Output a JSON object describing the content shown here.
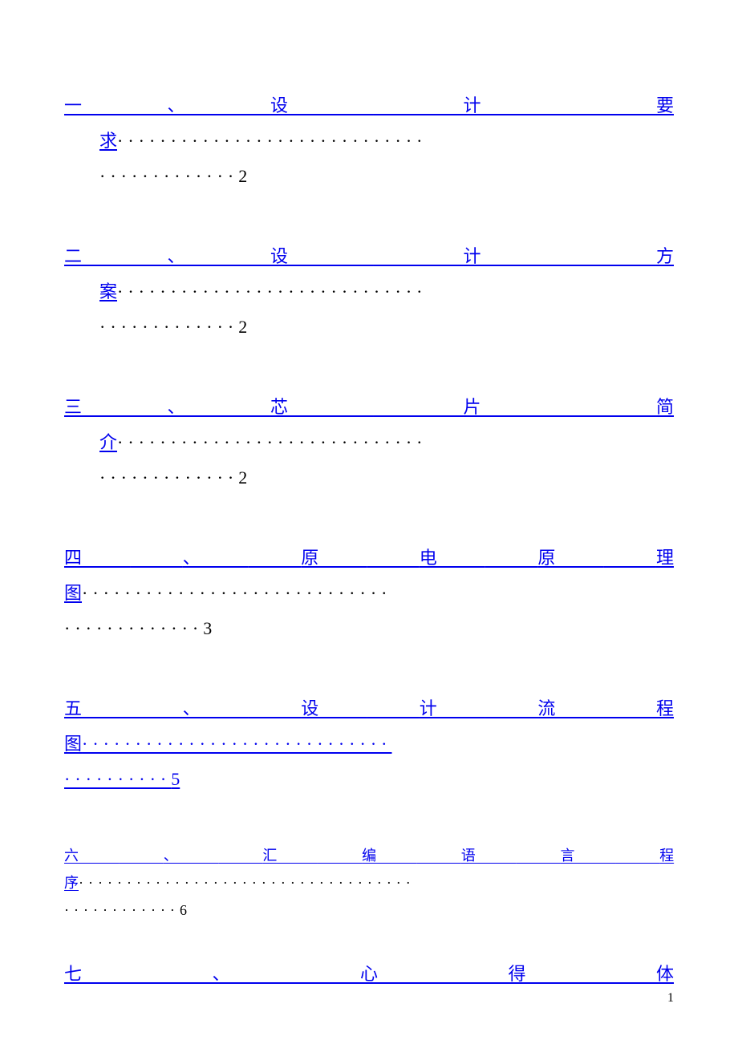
{
  "toc": [
    {
      "num": "一、",
      "title_chars": [
        "设",
        "计",
        "要",
        "求"
      ],
      "page": "2",
      "indent": true,
      "fullLink": false,
      "small": false
    },
    {
      "num": "二、",
      "title_chars": [
        "设",
        "计",
        "方",
        "案"
      ],
      "page": "2",
      "indent": true,
      "fullLink": false,
      "small": false
    },
    {
      "num": "三、",
      "title_chars": [
        "芯",
        "片",
        "简",
        "介"
      ],
      "page": "2",
      "indent": true,
      "fullLink": false,
      "small": false
    },
    {
      "num": "",
      "title_chars": [
        "四",
        "、",
        "原",
        "电",
        "原",
        "理",
        "图"
      ],
      "page": "3",
      "indent": false,
      "fullLink": false,
      "small": false
    },
    {
      "num": "",
      "title_chars": [
        "五",
        "、",
        "设",
        "计",
        "流",
        "程",
        "图"
      ],
      "page": "5",
      "indent": false,
      "fullLink": true,
      "small": false
    },
    {
      "num": "",
      "title_chars": [
        "六",
        "、",
        "汇",
        "编",
        "语",
        "言",
        "程",
        "序"
      ],
      "page": "6",
      "indent": false,
      "fullLink": false,
      "small": true
    },
    {
      "num": "",
      "title_chars": [
        "七",
        "、",
        "心",
        "得",
        "体"
      ],
      "page": "",
      "indent": false,
      "fullLink": false,
      "small": false
    }
  ],
  "dots": {
    "long": "·····························",
    "tail": "·············",
    "five_long": "·····························",
    "five_tail": "··········",
    "six_long": "···································",
    "six_tail": "············"
  },
  "footer_page": "1"
}
